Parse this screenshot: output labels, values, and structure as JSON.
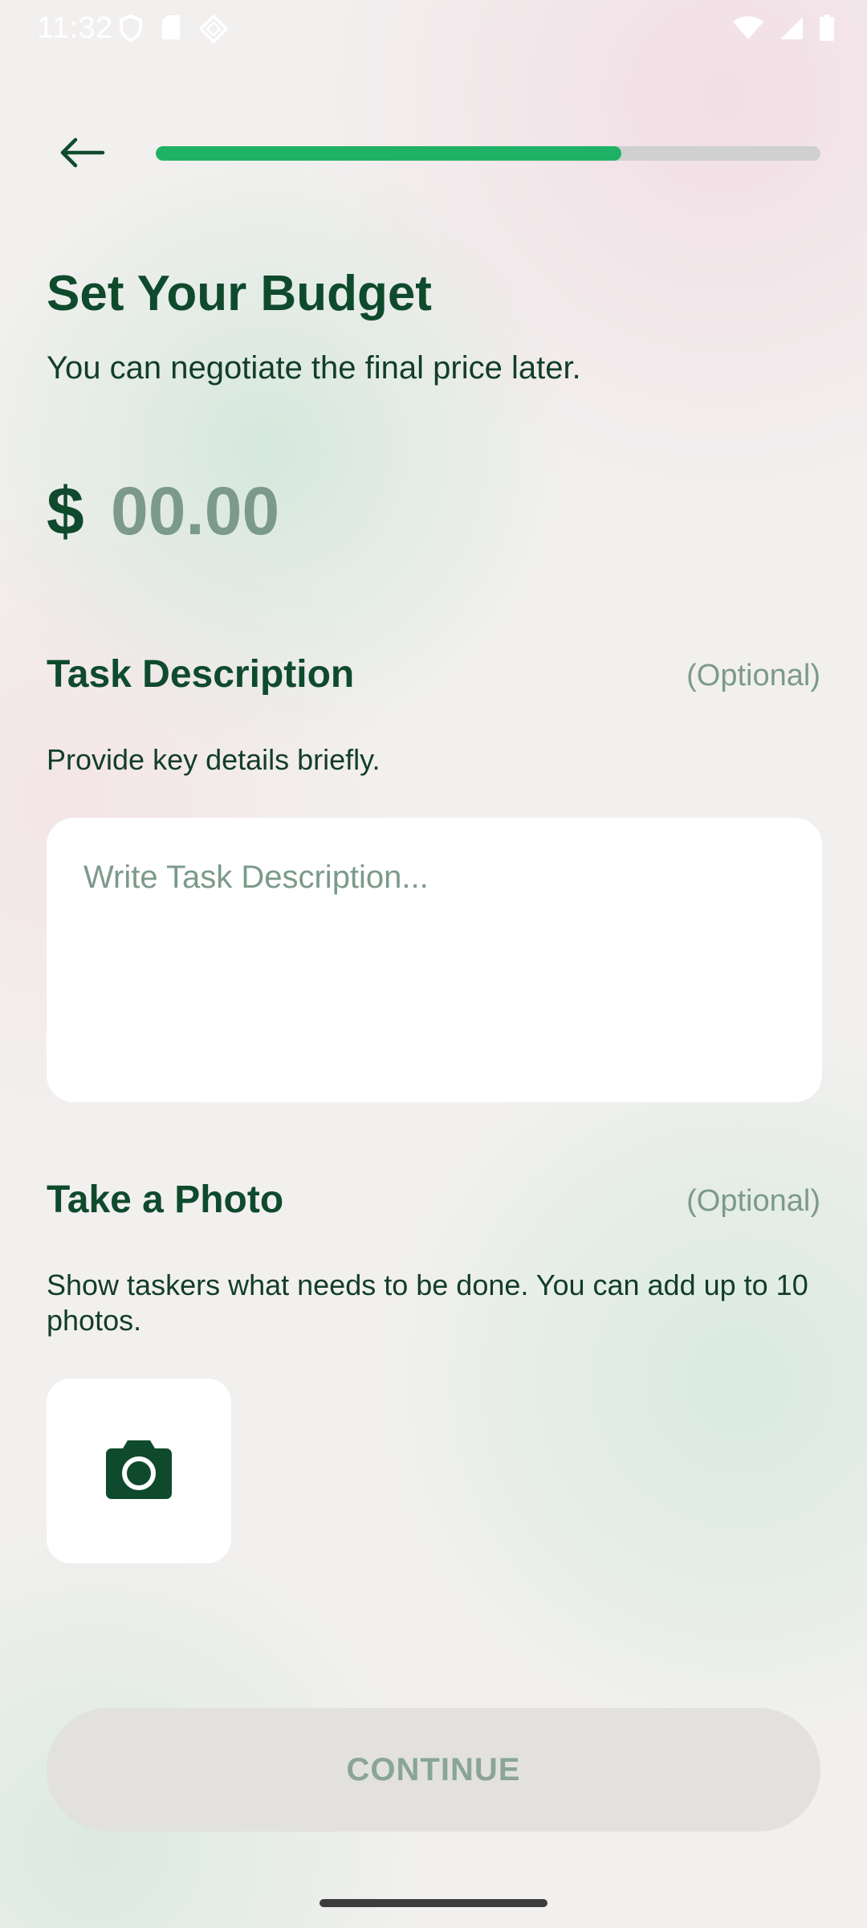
{
  "status_bar": {
    "time": "11:32",
    "left_icons": [
      "shield-icon",
      "sd-card-icon",
      "diamond-icon"
    ],
    "right_icons": [
      "wifi-icon",
      "signal-icon",
      "battery-icon"
    ]
  },
  "header": {
    "back_icon": "arrow-left-icon",
    "progress": 0.7
  },
  "budget": {
    "title": "Set Your Budget",
    "subtitle": "You can negotiate the final price later.",
    "currency_symbol": "$",
    "amount_placeholder": "00.00"
  },
  "task_description": {
    "title": "Task Description",
    "optional_label": "(Optional)",
    "subtitle": "Provide key details briefly.",
    "placeholder": "Write Task Description..."
  },
  "photo": {
    "title": "Take a Photo",
    "optional_label": "(Optional)",
    "subtitle": "Show taskers what needs to be done. You can add up to 10 photos.",
    "button_icon": "camera-icon"
  },
  "actions": {
    "continue_label": "CONTINUE"
  },
  "colors": {
    "primary_dark": "#0f4a2d",
    "accent": "#1fb266",
    "muted": "#7c9a8b",
    "disabled_button": "#e2e1e0"
  }
}
